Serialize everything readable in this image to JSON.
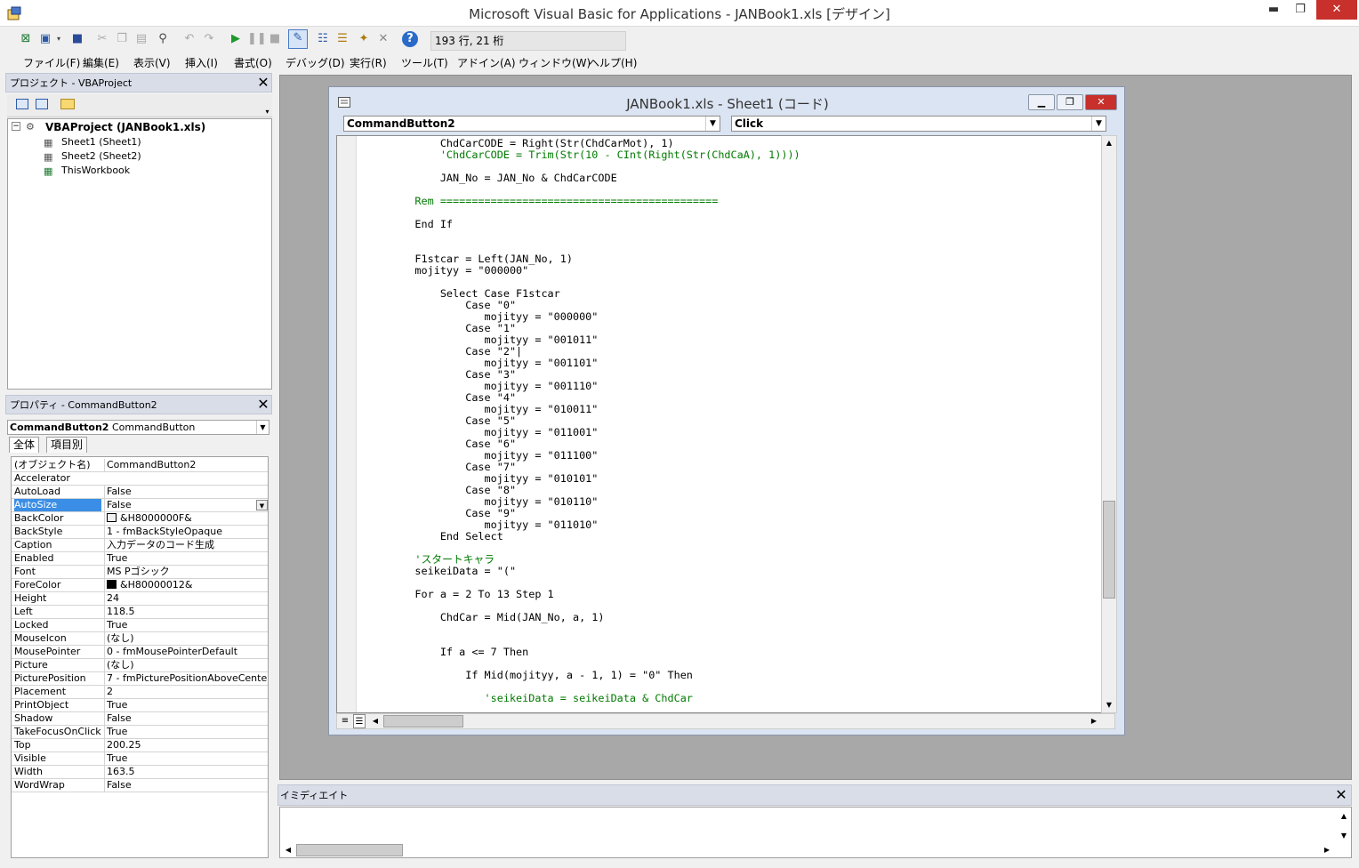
{
  "window": {
    "title": "Microsoft Visual Basic for Applications - JANBook1.xls [デザイン]",
    "min": "▬",
    "max": "❐",
    "close": "✕"
  },
  "toolbar": {
    "position": "193 行, 21 桁",
    "icons": [
      "excel-icon",
      "insert-form-icon",
      "save-icon",
      "cut-icon",
      "copy-icon",
      "paste-icon",
      "find-icon",
      "undo-icon",
      "redo-icon",
      "run-icon",
      "break-icon",
      "reset-icon",
      "design-mode-icon",
      "project-explorer-icon",
      "properties-icon",
      "object-browser-icon",
      "toolbox-icon",
      "help-icon"
    ]
  },
  "menu": [
    "ファイル(F)",
    "編集(E)",
    "表示(V)",
    "挿入(I)",
    "書式(O)",
    "デバッグ(D)",
    "実行(R)",
    "ツール(T)",
    "アドイン(A)",
    "ウィンドウ(W)",
    "ヘルプ(H)"
  ],
  "project": {
    "title": "プロジェクト - VBAProject",
    "root": "VBAProject (JANBook1.xls)",
    "items": [
      "Sheet1 (Sheet1)",
      "Sheet2 (Sheet2)",
      "ThisWorkbook"
    ]
  },
  "properties": {
    "title": "プロパティ - CommandButton2",
    "object_name": "CommandButton2",
    "object_type": "CommandButton",
    "tabs": [
      "全体",
      "項目別"
    ],
    "rows": [
      {
        "name": "(オブジェクト名)",
        "value": "CommandButton2"
      },
      {
        "name": "Accelerator",
        "value": ""
      },
      {
        "name": "AutoLoad",
        "value": "False"
      },
      {
        "name": "AutoSize",
        "value": "False"
      },
      {
        "name": "BackColor",
        "value": "&H8000000F&"
      },
      {
        "name": "BackStyle",
        "value": "1 - fmBackStyleOpaque"
      },
      {
        "name": "Caption",
        "value": "入力データのコード生成"
      },
      {
        "name": "Enabled",
        "value": "True"
      },
      {
        "name": "Font",
        "value": "MS Pゴシック"
      },
      {
        "name": "ForeColor",
        "value": "&H80000012&"
      },
      {
        "name": "Height",
        "value": "24"
      },
      {
        "name": "Left",
        "value": "118.5"
      },
      {
        "name": "Locked",
        "value": "True"
      },
      {
        "name": "MouseIcon",
        "value": "(なし)"
      },
      {
        "name": "MousePointer",
        "value": "0 - fmMousePointerDefault"
      },
      {
        "name": "Picture",
        "value": "(なし)"
      },
      {
        "name": "PicturePosition",
        "value": "7 - fmPicturePositionAboveCenter"
      },
      {
        "name": "Placement",
        "value": "2"
      },
      {
        "name": "PrintObject",
        "value": "True"
      },
      {
        "name": "Shadow",
        "value": "False"
      },
      {
        "name": "TakeFocusOnClick",
        "value": "True"
      },
      {
        "name": "Top",
        "value": "200.25"
      },
      {
        "name": "Visible",
        "value": "True"
      },
      {
        "name": "Width",
        "value": "163.5"
      },
      {
        "name": "WordWrap",
        "value": "False"
      }
    ],
    "selected_row": "AutoSize",
    "backcolor_swatch": "#f0f0f0",
    "forecolor_swatch": "#000000"
  },
  "code_window": {
    "title": "JANBook1.xls - Sheet1 (コード)",
    "object_combo": "CommandButton2",
    "proc_combo": "Click",
    "lines": [
      {
        "text": "        ChdCarCODE = Right(Str(ChdCarMot), 1)",
        "type": "code"
      },
      {
        "text": "        'ChdCarCODE = Trim(Str(10 - CInt(Right(Str(ChdCaA), 1))))",
        "type": "comment"
      },
      {
        "text": "",
        "type": "code"
      },
      {
        "text": "        JAN_No = JAN_No & ChdCarCODE",
        "type": "code"
      },
      {
        "text": "",
        "type": "code"
      },
      {
        "text": "    Rem ============================================",
        "type": "comment"
      },
      {
        "text": "",
        "type": "code"
      },
      {
        "text": "    End If",
        "type": "kw"
      },
      {
        "text": "",
        "type": "code"
      },
      {
        "text": "",
        "type": "code"
      },
      {
        "text": "    F1stcar = Left(JAN_No, 1)",
        "type": "code"
      },
      {
        "text": "    mojityy = \"000000\"",
        "type": "code"
      },
      {
        "text": "",
        "type": "code"
      },
      {
        "text": "        Select Case F1stcar",
        "type": "kw"
      },
      {
        "text": "            Case \"0\"",
        "type": "kw"
      },
      {
        "text": "               mojityy = \"000000\"",
        "type": "code"
      },
      {
        "text": "            Case \"1\"",
        "type": "kw"
      },
      {
        "text": "               mojityy = \"001011\"",
        "type": "code"
      },
      {
        "text": "            Case \"2\"|",
        "type": "kw"
      },
      {
        "text": "               mojityy = \"001101\"",
        "type": "code"
      },
      {
        "text": "            Case \"3\"",
        "type": "kw"
      },
      {
        "text": "               mojityy = \"001110\"",
        "type": "code"
      },
      {
        "text": "            Case \"4\"",
        "type": "kw"
      },
      {
        "text": "               mojityy = \"010011\"",
        "type": "code"
      },
      {
        "text": "            Case \"5\"",
        "type": "kw"
      },
      {
        "text": "               mojityy = \"011001\"",
        "type": "code"
      },
      {
        "text": "            Case \"6\"",
        "type": "kw"
      },
      {
        "text": "               mojityy = \"011100\"",
        "type": "code"
      },
      {
        "text": "            Case \"7\"",
        "type": "kw"
      },
      {
        "text": "               mojityy = \"010101\"",
        "type": "code"
      },
      {
        "text": "            Case \"8\"",
        "type": "kw"
      },
      {
        "text": "               mojityy = \"010110\"",
        "type": "code"
      },
      {
        "text": "            Case \"9\"",
        "type": "kw"
      },
      {
        "text": "               mojityy = \"011010\"",
        "type": "code"
      },
      {
        "text": "        End Select",
        "type": "kw"
      },
      {
        "text": "",
        "type": "code"
      },
      {
        "text": "    'スタートキャラ",
        "type": "comment"
      },
      {
        "text": "    seikeiData = \"(\"",
        "type": "code"
      },
      {
        "text": "",
        "type": "code"
      },
      {
        "text": "    For a = 2 To 13 Step 1",
        "type": "kw"
      },
      {
        "text": "",
        "type": "code"
      },
      {
        "text": "        ChdCar = Mid(JAN_No, a, 1)",
        "type": "code"
      },
      {
        "text": "",
        "type": "code"
      },
      {
        "text": "",
        "type": "code"
      },
      {
        "text": "        If a <= 7 Then",
        "type": "kw"
      },
      {
        "text": "",
        "type": "code"
      },
      {
        "text": "            If Mid(mojityy, a - 1, 1) = \"0\" Then",
        "type": "kw"
      },
      {
        "text": "",
        "type": "code"
      },
      {
        "text": "               'seikeiData = seikeiData & ChdCar",
        "type": "comment"
      }
    ]
  },
  "immediate": {
    "title": "イミディエイト"
  }
}
